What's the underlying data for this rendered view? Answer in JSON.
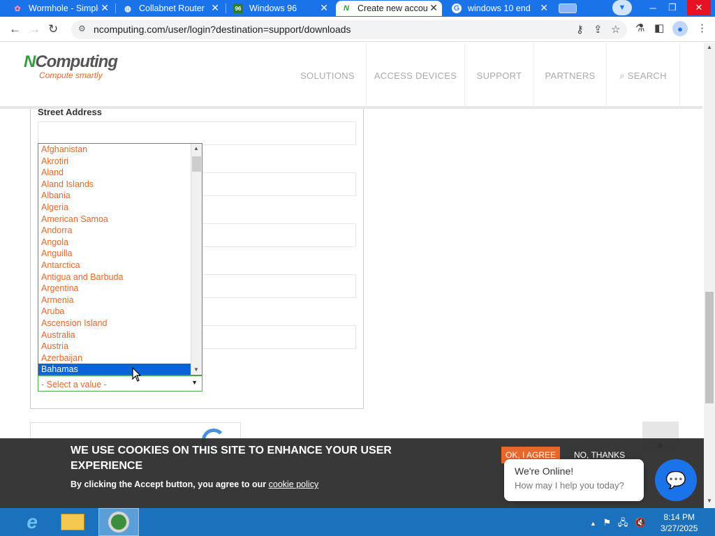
{
  "browser": {
    "tabs": [
      {
        "title": "Wormhole - Simple",
        "icon": "wormhole-icon"
      },
      {
        "title": "Collabnet Router",
        "icon": "globe-icon"
      },
      {
        "title": "Windows 96",
        "icon": "windows96-icon"
      },
      {
        "title": "Create new account",
        "icon": "ncomputing-icon",
        "active": true
      },
      {
        "title": "windows 10 end",
        "icon": "google-icon"
      }
    ],
    "url": "ncomputing.com/user/login?destination=support/downloads"
  },
  "site": {
    "logo_name": "NComputing",
    "logo_tagline": "Compute smartly",
    "nav": [
      "SOLUTIONS",
      "ACCESS DEVICES",
      "SUPPORT",
      "PARTNERS",
      "SEARCH"
    ]
  },
  "form": {
    "street_address_label": "Street Address",
    "country_options": [
      "Afghanistan",
      "Akrotiri",
      "Aland",
      "Aland Islands",
      "Albania",
      "Algeria",
      "American Samoa",
      "Andorra",
      "Angola",
      "Anguilla",
      "Antarctica",
      "Antigua and Barbuda",
      "Argentina",
      "Armenia",
      "Aruba",
      "Ascension Island",
      "Australia",
      "Austria",
      "Azerbaijan",
      "Bahamas"
    ],
    "highlighted_option": "Bahamas",
    "select_value": "- Select a value -"
  },
  "cookie": {
    "heading": "WE USE COOKIES ON THIS SITE TO ENHANCE YOUR USER EXPERIENCE",
    "text": "By clicking the Accept button, you agree to our",
    "link": "cookie policy",
    "ok": "OK, I AGREE",
    "no": "NO, THANKS"
  },
  "chat": {
    "status": "We're Online!",
    "prompt": "How may I help you today?"
  },
  "taskbar": {
    "time": "8:14 PM",
    "date": "3/27/2025"
  },
  "colors": {
    "accent": "#e8672a",
    "chrome_blue": "#1a73e8",
    "taskbar": "#1c71bd"
  }
}
